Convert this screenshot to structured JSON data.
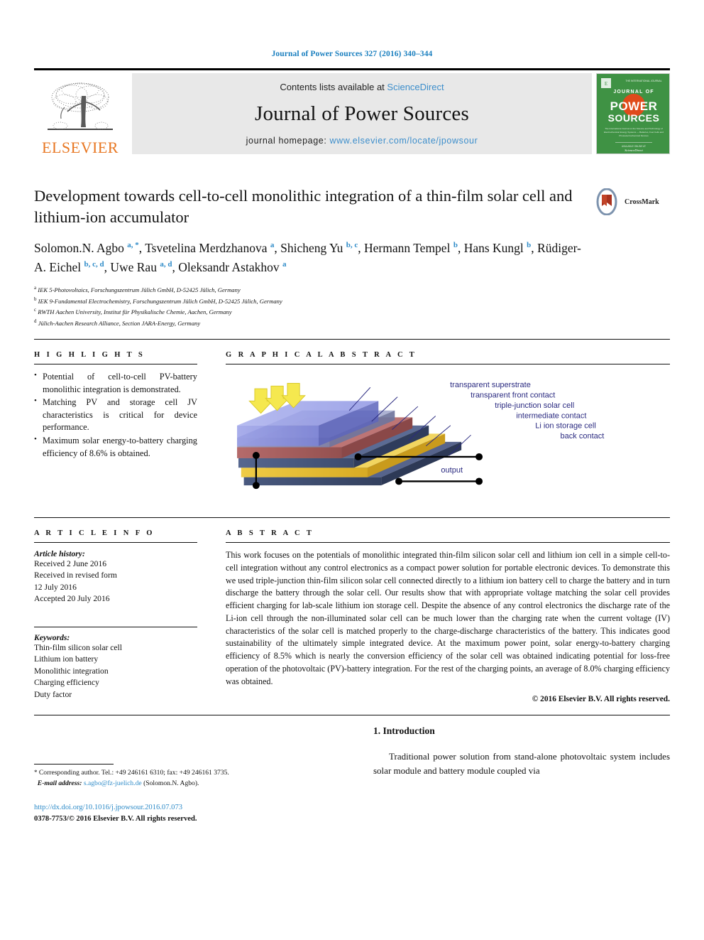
{
  "running_head": "Journal of Power Sources 327 (2016) 340–344",
  "masthead": {
    "publisher_name": "ELSEVIER",
    "contents_prefix": "Contents lists available at ",
    "contents_link": "ScienceDirect",
    "journal_title": "Journal of Power Sources",
    "homepage_prefix": "journal homepage: ",
    "homepage_url": "www.elsevier.com/locate/jpowsour",
    "cover_title_line1": "JOURNAL OF",
    "cover_title_line2": "POWER",
    "cover_title_line3": "SOURCES",
    "cover_color": "#3f9244",
    "accent_link_color": "#3d8ecb",
    "elsevier_orange": "#e87722"
  },
  "article": {
    "title": "Development towards cell-to-cell monolithic integration of a thin-film solar cell and lithium-ion accumulator",
    "crossmark_label": "CrossMark",
    "authors_html": "Solomon.N. Agbo <sup>a, *</sup>, Tsvetelina Merdzhanova <sup>a</sup>, Shicheng Yu <sup>b, c</sup>, Hermann Tempel <sup>b</sup>, Hans Kungl <sup>b</sup>, Rüdiger-A. Eichel <sup>b, c, d</sup>, Uwe Rau <sup>a, d</sup>, Oleksandr Astakhov <sup>a</sup>",
    "affiliations": [
      {
        "mark": "a",
        "text": "IEK 5-Photovoltaics, Forschungszentrum Jülich GmbH, D-52425 Jülich, Germany"
      },
      {
        "mark": "b",
        "text": "IEK 9-Fundamental Electrochemistry, Forschungszentrum Jülich GmbH, D-52425 Jülich, Germany"
      },
      {
        "mark": "c",
        "text": "RWTH Aachen University, Institut für Physikalische Chemie, Aachen, Germany"
      },
      {
        "mark": "d",
        "text": "Jülich-Aachen Research Alliance, Section JARA-Energy, Germany"
      }
    ]
  },
  "highlights": {
    "heading": "H I G H L I G H T S",
    "items": [
      "Potential of cell-to-cell PV-battery monolithic integration is demonstrated.",
      "Matching PV and storage cell JV characteristics is critical for device performance.",
      "Maximum solar energy-to-battery charging efficiency of 8.6% is obtained."
    ]
  },
  "graphical_abstract": {
    "heading": "G R A P H I C A L   A B S T R A C T",
    "layer_labels": [
      "transparent superstrate",
      "transparent front contact",
      "triple-junction solar cell",
      "intermediate contact",
      "Li ion storage cell",
      "back contact"
    ],
    "output_label": "output",
    "colors": {
      "superstrate": "#8f96e0",
      "front_contact": "#8a8fb8",
      "solar_cell": "#a85a5a",
      "intermediate_contact": "#4a5a80",
      "storage_cell": "#e8c038",
      "back_contact": "#3e4d72",
      "sun_arrows": "#f5e84f",
      "label_text": "#2a2a80"
    }
  },
  "article_info": {
    "heading": "A R T I C L E   I N F O",
    "history_label": "Article history:",
    "history_lines": [
      "Received 2 June 2016",
      "Received in revised form",
      "12 July 2016",
      "Accepted 20 July 2016"
    ],
    "keywords_label": "Keywords:",
    "keywords": [
      "Thin-film silicon solar cell",
      "Lithium ion battery",
      "Monolithic integration",
      "Charging efficiency",
      "Duty factor"
    ]
  },
  "abstract": {
    "heading": "A B S T R A C T",
    "body": "This work focuses on the potentials of monolithic integrated thin-film silicon solar cell and lithium ion cell in a simple cell-to-cell integration without any control electronics as a compact power solution for portable electronic devices. To demonstrate this we used triple-junction thin-film silicon solar cell connected directly to a lithium ion battery cell to charge the battery and in turn discharge the battery through the solar cell. Our results show that with appropriate voltage matching the solar cell provides efficient charging for lab-scale lithium ion storage cell. Despite the absence of any control electronics the discharge rate of the Li-ion cell through the non-illuminated solar cell can be much lower than the charging rate when the current voltage (IV) characteristics of the solar cell is matched properly to the charge-discharge characteristics of the battery. This indicates good sustainability of the ultimately simple integrated device. At the maximum power point, solar energy-to-battery charging efficiency of 8.5% which is nearly the conversion efficiency of the solar cell was obtained indicating potential for loss-free operation of the photovoltaic (PV)-battery integration. For the rest of the charging points, an average of 8.0% charging efficiency was obtained.",
    "copyright": "© 2016 Elsevier B.V. All rights reserved."
  },
  "introduction": {
    "heading": "1. Introduction",
    "paragraph": "Traditional power solution from stand-alone photovoltaic system includes solar module and battery module coupled via"
  },
  "footer": {
    "corresponding_star": "*",
    "corresponding_text": "Corresponding author. Tel.: +49 246161 6310; fax: +49 246161 3735.",
    "email_label": "E-mail address:",
    "email": "s.agbo@fz-juelich.de",
    "email_owner": "(Solomon.N. Agbo).",
    "doi_url": "http://dx.doi.org/10.1016/j.jpowsour.2016.07.073",
    "issn_line": "0378-7753/© 2016 Elsevier B.V. All rights reserved."
  }
}
